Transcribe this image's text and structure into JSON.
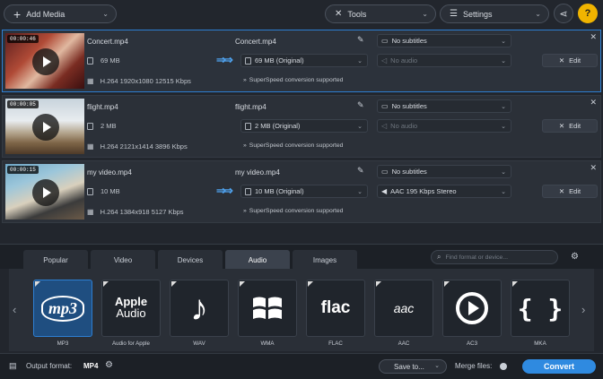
{
  "toolbar": {
    "add_media_label": "Add Media",
    "tools_label": "Tools",
    "settings_label": "Settings"
  },
  "files": [
    {
      "duration": "00:00:46",
      "source_name": "Concert.mp4",
      "source_size": "69 MB",
      "source_info": "H.264 1920x1080 12515 Kbps",
      "output_name": "Concert.mp4",
      "output_size": "69 MB (Original)",
      "subtitles": "No subtitles",
      "audio": "No audio",
      "superspeed": "SuperSpeed conversion supported",
      "edit_label": "Edit"
    },
    {
      "duration": "00:00:05",
      "source_name": "flight.mp4",
      "source_size": "2 MB",
      "source_info": "H.264 2121x1414 3896 Kbps",
      "output_name": "flight.mp4",
      "output_size": "2 MB (Original)",
      "subtitles": "No subtitles",
      "audio": "No audio",
      "superspeed": "SuperSpeed conversion supported",
      "edit_label": "Edit"
    },
    {
      "duration": "00:00:15",
      "source_name": "my video.mp4",
      "source_size": "10 MB",
      "source_info": "H.264 1384x918 5127 Kbps",
      "output_name": "my video.mp4",
      "output_size": "10 MB (Original)",
      "subtitles": "No subtitles",
      "audio": "AAC 195 Kbps Stereo",
      "superspeed": "SuperSpeed conversion supported",
      "edit_label": "Edit"
    }
  ],
  "tabs": [
    "Popular",
    "Video",
    "Devices",
    "Audio",
    "Images"
  ],
  "active_tab": "Audio",
  "search": {
    "placeholder": "Find format or device..."
  },
  "formats": [
    {
      "label": "MP3",
      "icon": "mp3-icon"
    },
    {
      "label": "Audio for Apple",
      "icon": "apple-audio-icon"
    },
    {
      "label": "WAV",
      "icon": "music-note-icon"
    },
    {
      "label": "WMA",
      "icon": "windows-icon"
    },
    {
      "label": "FLAC",
      "icon": "flac-icon"
    },
    {
      "label": "AAC",
      "icon": "aac-icon"
    },
    {
      "label": "AC3",
      "icon": "ac3-icon"
    },
    {
      "label": "MKA",
      "icon": "mka-icon"
    }
  ],
  "format_logos": {
    "mp3": "mp3",
    "apple_line1": "Apple",
    "apple_line2": "Audio",
    "flac": "flac",
    "aac": "aac"
  },
  "footer": {
    "output_format_label": "Output format:",
    "output_format_value": "MP4",
    "save_to_label": "Save to...",
    "merge_files_label": "Merge files:",
    "convert_label": "Convert"
  },
  "colors": {
    "accent": "#2f8ae0",
    "background": "#22262d",
    "selected_border": "#2d7fd3"
  }
}
